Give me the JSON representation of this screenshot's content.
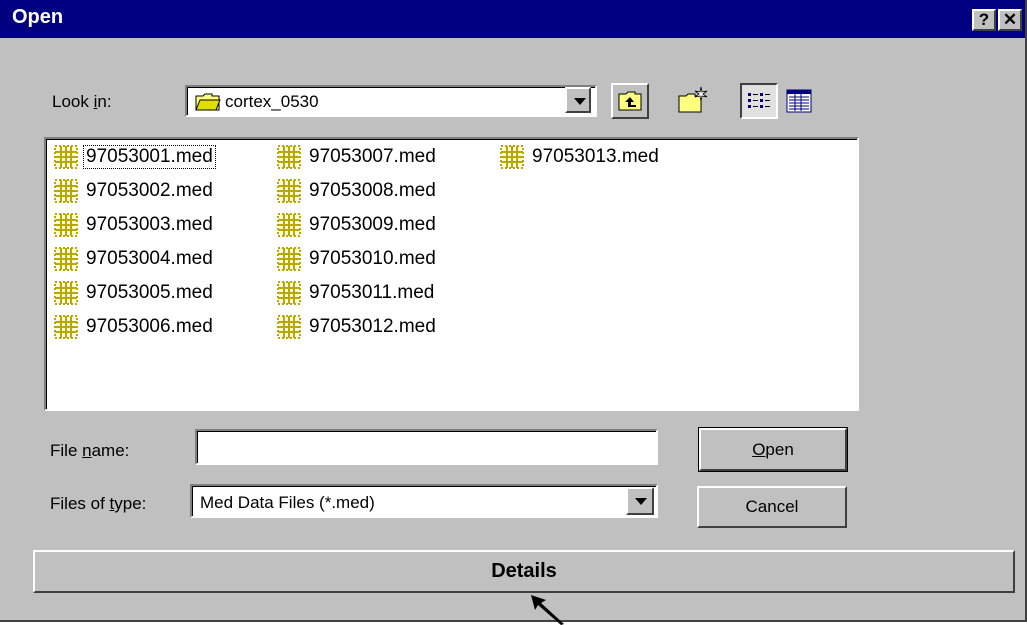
{
  "window": {
    "title": "Open",
    "help_label": "?",
    "close_label": "✕"
  },
  "look_in": {
    "label_pre": "Look ",
    "label_u": "i",
    "label_post": "n:",
    "value": "cortex_0530"
  },
  "toolbar": {
    "up_icon": "folder-up-icon",
    "new_folder_icon": "new-folder-icon",
    "list_icon": "list-view-icon",
    "details_icon": "details-view-icon"
  },
  "files": [
    "97053001.med",
    "97053002.med",
    "97053003.med",
    "97053004.med",
    "97053005.med",
    "97053006.med",
    "97053007.med",
    "97053008.med",
    "97053009.med",
    "97053010.med",
    "97053011.med",
    "97053012.med",
    "97053013.med"
  ],
  "file_name": {
    "label_pre": "File ",
    "label_u": "n",
    "label_post": "ame:",
    "value": ""
  },
  "file_type": {
    "label_pre": "Files of ",
    "label_u": "t",
    "label_post": "ype:",
    "value": "Med Data Files (*.med)"
  },
  "buttons": {
    "open_u": "O",
    "open_rest": "pen",
    "cancel": "Cancel",
    "details": "Details"
  },
  "colors": {
    "title_bar": "#000080",
    "dialog": "#c0c0c0",
    "file_icon": "#b8a800"
  }
}
